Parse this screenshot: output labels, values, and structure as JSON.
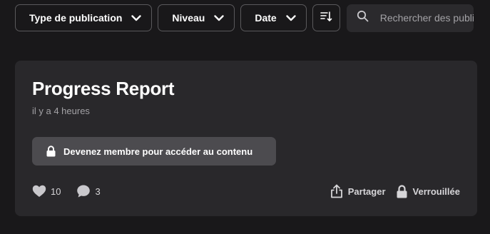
{
  "filters": {
    "publication_type": "Type de publication",
    "level": "Niveau",
    "date": "Date"
  },
  "search": {
    "placeholder": "Rechercher des publications"
  },
  "post": {
    "title": "Progress Report",
    "time": "il y a 4 heures",
    "member_button": "Devenez membre pour accéder au contenu",
    "likes": "10",
    "comments": "3",
    "share_label": "Partager",
    "locked_label": "Verrouillée"
  },
  "icons": {
    "chevron": "chevron-down-icon",
    "sort": "sort-icon",
    "search": "search-icon",
    "lock": "lock-icon",
    "heart": "heart-icon",
    "comment": "comment-icon",
    "share": "share-icon"
  },
  "colors": {
    "page_bg": "#19181a",
    "card_bg": "#29282b",
    "button_bg": "#4c4b4f",
    "muted_text": "#a3a2a6"
  }
}
